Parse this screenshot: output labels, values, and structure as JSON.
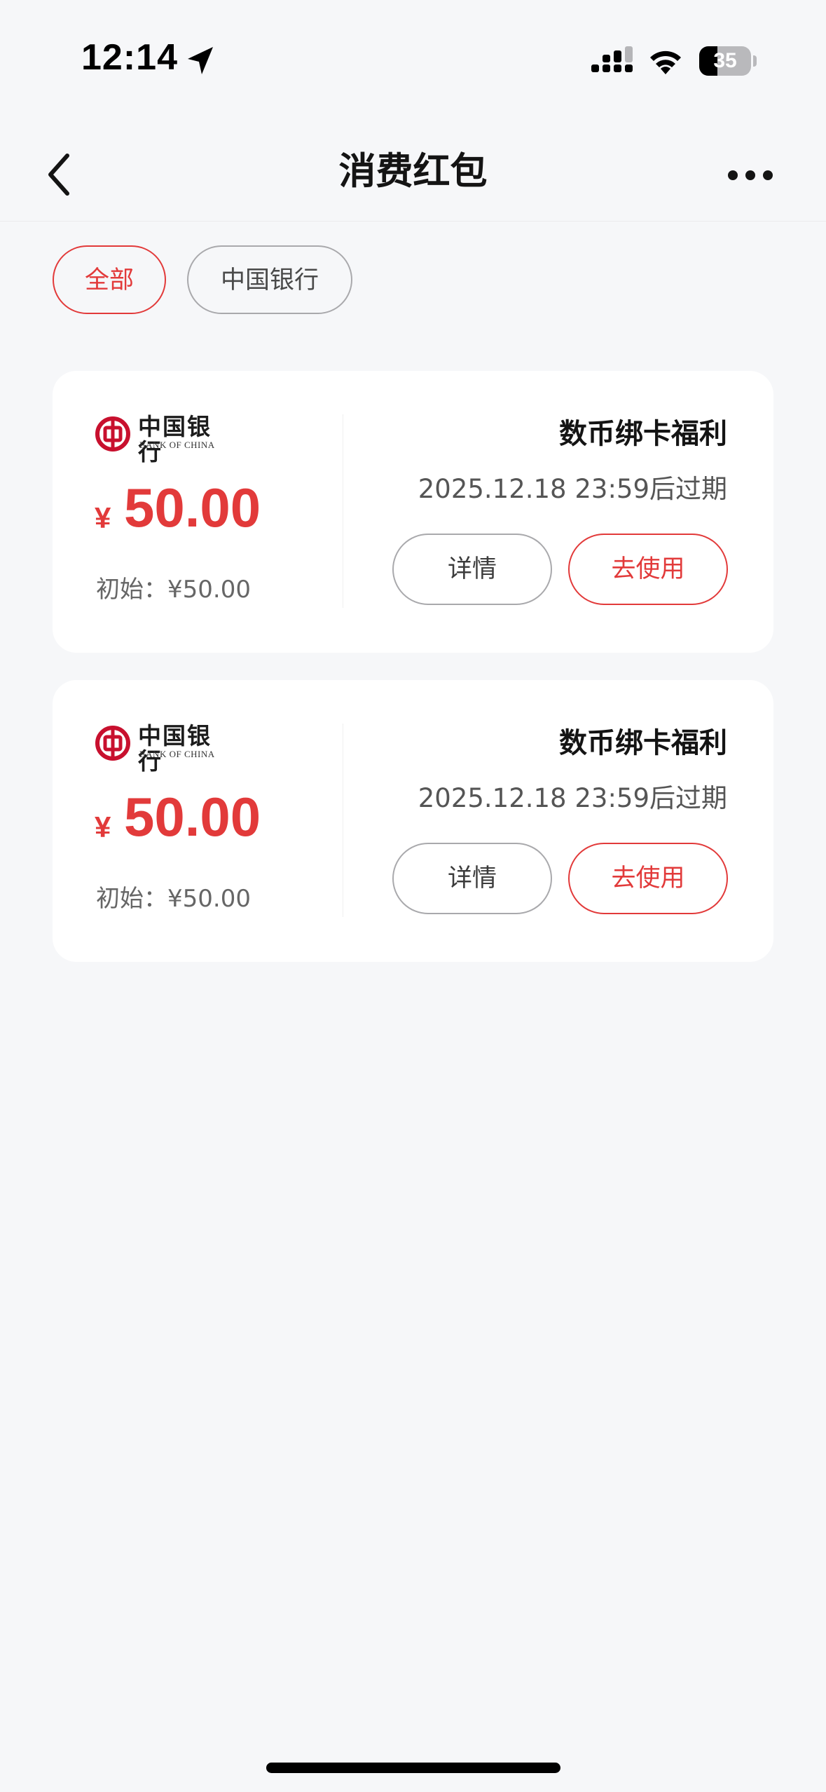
{
  "status_bar": {
    "time": "12:14",
    "battery_level": "35",
    "battery_fraction": 0.35,
    "icons": [
      "location-arrow-icon",
      "signal-icon",
      "wifi-icon",
      "battery-icon"
    ]
  },
  "nav": {
    "title": "消费红包",
    "back_icon": "chevron-left-icon",
    "more_icon": "ellipsis-icon"
  },
  "filters": {
    "items": [
      {
        "label": "全部",
        "active": true
      },
      {
        "label": "中国银行",
        "active": false
      }
    ]
  },
  "coupons": [
    {
      "bank_name_cn": "中国银行",
      "bank_name_en": "BANK OF CHINA",
      "currency": "¥",
      "amount": "50.00",
      "initial": "初始：¥50.00",
      "title": "数币绑卡福利",
      "expiry": "2025.12.18 23:59后过期",
      "details_label": "详情",
      "use_label": "去使用"
    },
    {
      "bank_name_cn": "中国银行",
      "bank_name_en": "BANK OF CHINA",
      "currency": "¥",
      "amount": "50.00",
      "initial": "初始：¥50.00",
      "title": "数币绑卡福利",
      "expiry": "2025.12.18 23:59后过期",
      "details_label": "详情",
      "use_label": "去使用"
    }
  ],
  "colors": {
    "accent": "#e23a3a",
    "background": "#f6f7f9",
    "card": "#ffffff",
    "text_primary": "#141414",
    "text_secondary": "#666666",
    "bank_red": "#c8102e"
  }
}
